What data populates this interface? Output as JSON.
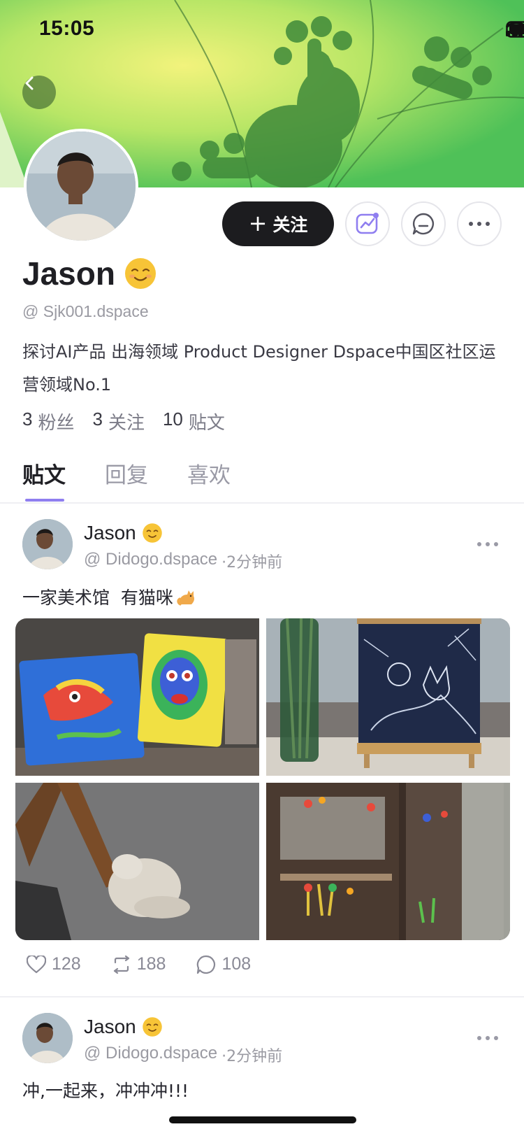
{
  "status_bar": {
    "time": "15:05"
  },
  "header": {
    "back_icon": "chevron-left-icon"
  },
  "profile": {
    "name": "Jason",
    "name_emoji": "smiling-face-icon",
    "handle": "@ Sjk001.dspace",
    "bio": "探讨AI产品  出海领域 Product Designer  Dspace中国区社区运营领域No.1",
    "stats": [
      {
        "value": "3",
        "label": "粉丝"
      },
      {
        "value": "3",
        "label": "关注"
      },
      {
        "value": "10",
        "label": "贴文"
      }
    ],
    "follow_label": "关注",
    "follow_icon": "plus-icon",
    "action_icons": [
      "chart-icon",
      "message-icon",
      "more-icon"
    ]
  },
  "tabs": [
    {
      "label": "贴文",
      "active": true
    },
    {
      "label": "回复",
      "active": false
    },
    {
      "label": "喜欢",
      "active": false
    }
  ],
  "posts": [
    {
      "author": "Jason",
      "handle": "@ Didogo.dspace",
      "time": "·2分钟前",
      "text": "一家美术馆  有猫咪",
      "text_emoji": "cat-icon",
      "photos": [
        "clay-dragon-art",
        "chalk-drawing-frame",
        "sleeping-cat",
        "museum-display-cases"
      ],
      "likes": "128",
      "reposts": "188",
      "comments": "108"
    },
    {
      "author": "Jason",
      "handle": "@ Didogo.dspace",
      "time": "·2分钟前",
      "text": "冲,一起来，冲冲冲!!!"
    }
  ],
  "colors": {
    "accent": "#8f7ef0",
    "follow_button": "#1c1c1f",
    "banner_green": "#7fd85e"
  }
}
